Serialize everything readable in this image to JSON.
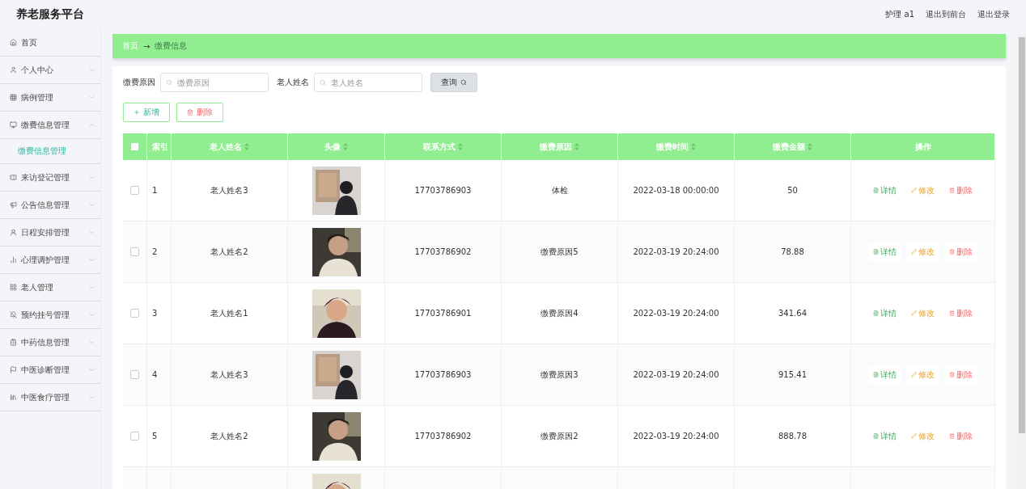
{
  "header": {
    "title": "养老服务平台",
    "links": [
      "护理 a1",
      "退出到前台",
      "退出登录"
    ]
  },
  "sidebar": {
    "items": [
      {
        "label": "首页",
        "kind": "link"
      },
      {
        "label": "个人中心",
        "kind": "group",
        "expanded": false
      },
      {
        "label": "病例管理",
        "kind": "group",
        "expanded": false
      },
      {
        "label": "缴费信息管理",
        "kind": "group",
        "expanded": true,
        "children": [
          {
            "label": "缴费信息管理",
            "selected": true
          }
        ]
      },
      {
        "label": "来访登记管理",
        "kind": "group",
        "expanded": false
      },
      {
        "label": "公告信息管理",
        "kind": "group",
        "expanded": false
      },
      {
        "label": "日程安排管理",
        "kind": "group",
        "expanded": false
      },
      {
        "label": "心理调护管理",
        "kind": "group",
        "expanded": false
      },
      {
        "label": "老人管理",
        "kind": "group",
        "expanded": false
      },
      {
        "label": "预约挂号管理",
        "kind": "group",
        "expanded": false
      },
      {
        "label": "中药信息管理",
        "kind": "group",
        "expanded": false
      },
      {
        "label": "中医诊断管理",
        "kind": "group",
        "expanded": false
      },
      {
        "label": "中医食疗管理",
        "kind": "group",
        "expanded": false
      }
    ]
  },
  "breadcrumb": [
    {
      "label": "首页",
      "kind": "link"
    },
    {
      "label": "→",
      "kind": "separator"
    },
    {
      "label": "缴费信息",
      "kind": "current"
    }
  ],
  "search": {
    "fields": [
      {
        "label": "缴费原因",
        "placeholder": "缴费原因"
      },
      {
        "label": "老人姓名",
        "placeholder": "老人姓名"
      }
    ],
    "button": "查询"
  },
  "actions": [
    {
      "label": "新增",
      "kind": "add"
    },
    {
      "label": "删除",
      "kind": "delete"
    }
  ],
  "table": {
    "columns": [
      {
        "label": "索引",
        "sortable": false
      },
      {
        "label": "老人姓名",
        "sortable": true
      },
      {
        "label": "头像",
        "sortable": true
      },
      {
        "label": "联系方式",
        "sortable": true
      },
      {
        "label": "缴费原因",
        "sortable": true
      },
      {
        "label": "缴费时间",
        "sortable": true
      },
      {
        "label": "缴费金额",
        "sortable": true
      },
      {
        "label": "操作",
        "sortable": false
      }
    ],
    "all_checked": false,
    "rows": [
      {
        "checked": false,
        "index": "1",
        "name": "老人姓名3",
        "avatar": {
          "kind": "picture"
        },
        "phone": "17703786903",
        "reason": "体检",
        "time": "2022-03-18 00:00:00",
        "amount": "50",
        "actions": [
          {
            "label": "详情",
            "kind": "view"
          },
          {
            "label": "修改",
            "kind": "edit"
          },
          {
            "label": "删除",
            "kind": "delete"
          }
        ]
      },
      {
        "checked": false,
        "index": "2",
        "name": "老人姓名2",
        "avatar": {
          "kind": "picture"
        },
        "phone": "17703786902",
        "reason": "缴费原因5",
        "time": "2022-03-19 20:24:00",
        "amount": "78.88",
        "actions": [
          {
            "label": "详情",
            "kind": "view"
          },
          {
            "label": "修改",
            "kind": "edit"
          },
          {
            "label": "删除",
            "kind": "delete"
          }
        ]
      },
      {
        "checked": false,
        "index": "3",
        "name": "老人姓名1",
        "avatar": {
          "kind": "picture"
        },
        "phone": "17703786901",
        "reason": "缴费原因4",
        "time": "2022-03-19 20:24:00",
        "amount": "341.64",
        "actions": [
          {
            "label": "详情",
            "kind": "view"
          },
          {
            "label": "修改",
            "kind": "edit"
          },
          {
            "label": "删除",
            "kind": "delete"
          }
        ]
      },
      {
        "checked": false,
        "index": "4",
        "name": "老人姓名3",
        "avatar": {
          "kind": "picture"
        },
        "phone": "17703786903",
        "reason": "缴费原因3",
        "time": "2022-03-19 20:24:00",
        "amount": "915.41",
        "actions": [
          {
            "label": "详情",
            "kind": "view"
          },
          {
            "label": "修改",
            "kind": "edit"
          },
          {
            "label": "删除",
            "kind": "delete"
          }
        ]
      },
      {
        "checked": false,
        "index": "5",
        "name": "老人姓名2",
        "avatar": {
          "kind": "picture"
        },
        "phone": "17703786902",
        "reason": "缴费原因2",
        "time": "2022-03-19 20:24:00",
        "amount": "888.78",
        "actions": [
          {
            "label": "详情",
            "kind": "view"
          },
          {
            "label": "修改",
            "kind": "edit"
          },
          {
            "label": "删除",
            "kind": "delete"
          }
        ]
      },
      {
        "avatar": {
          "kind": "picture"
        }
      }
    ]
  }
}
